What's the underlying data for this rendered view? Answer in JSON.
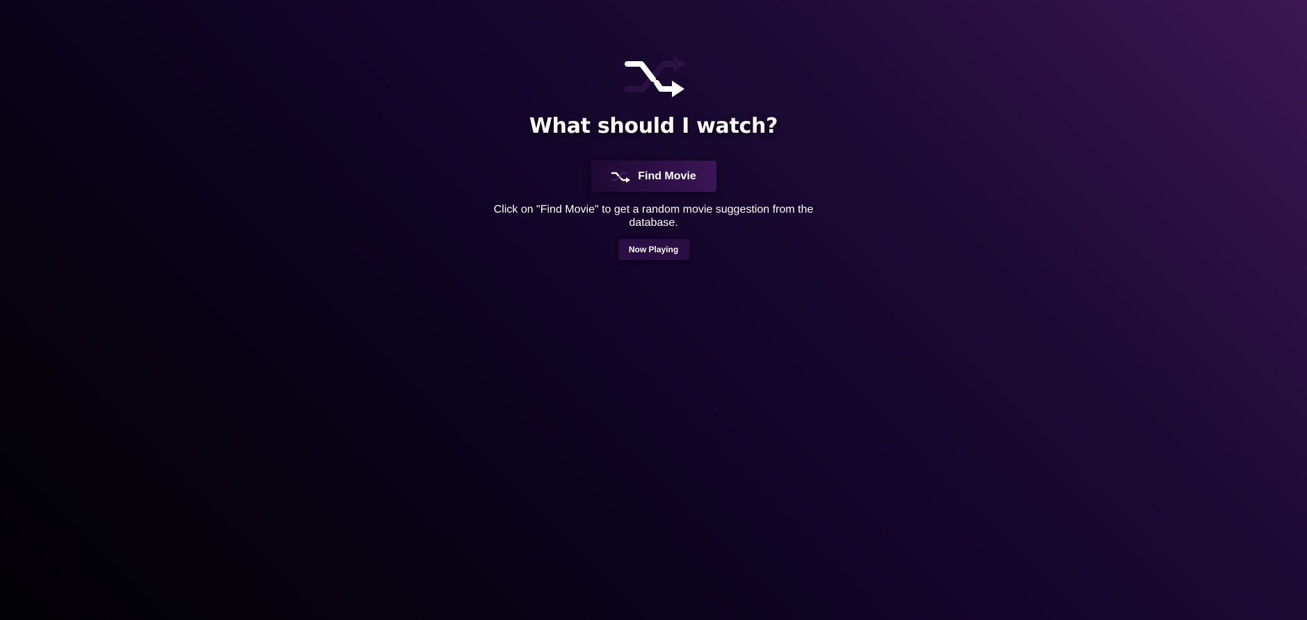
{
  "header": {
    "icon": "shuffle-icon",
    "title": "What should I watch?"
  },
  "find_button": {
    "icon": "shuffle-icon",
    "label": "Find Movie"
  },
  "helper_text": "Click on \"Find Movie\" to get a random movie suggestion from the database.",
  "now_playing_button": {
    "label": "Now Playing"
  },
  "colors": {
    "background_dark": "#020105",
    "background_accent": "#3d1652",
    "button_bg": "#2e1046",
    "text": "#ffffff"
  }
}
